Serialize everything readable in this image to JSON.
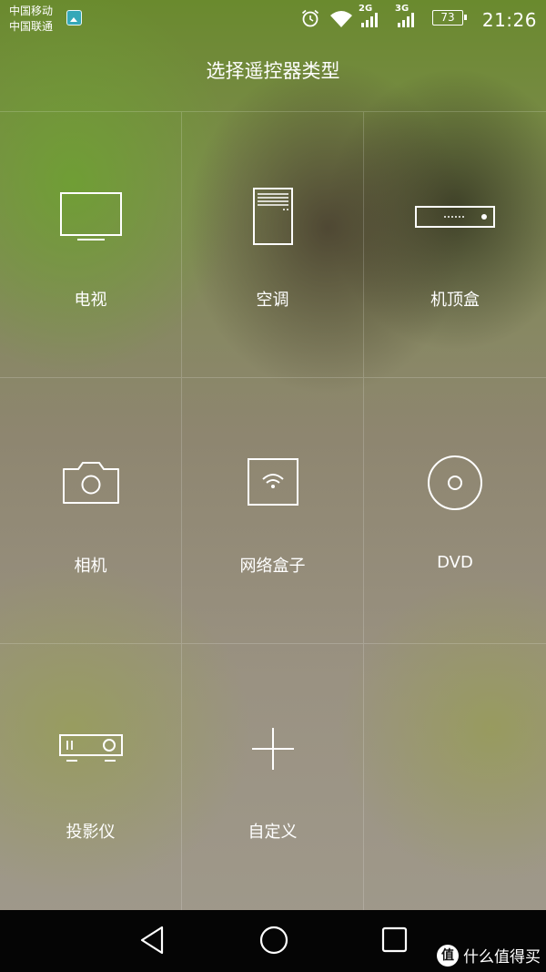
{
  "status_bar": {
    "carrier_1": "中国移动",
    "carrier_2": "中国联通",
    "network_1": "2G",
    "network_2": "3G",
    "battery_level": "73",
    "time": "21:26"
  },
  "header": {
    "title": "选择遥控器类型"
  },
  "device_types": [
    {
      "label": "电视",
      "icon": "tv-icon"
    },
    {
      "label": "空调",
      "icon": "air-conditioner-icon"
    },
    {
      "label": "机顶盒",
      "icon": "set-top-box-icon"
    },
    {
      "label": "相机",
      "icon": "camera-icon"
    },
    {
      "label": "网络盒子",
      "icon": "network-box-icon"
    },
    {
      "label": "DVD",
      "icon": "disc-icon"
    },
    {
      "label": "投影仪",
      "icon": "projector-icon"
    },
    {
      "label": "自定义",
      "icon": "plus-icon"
    }
  ],
  "watermark": {
    "badge": "值",
    "text": "什么值得买"
  },
  "colors": {
    "icon_stroke": "#ffffff",
    "nav_bar": "#050505"
  }
}
